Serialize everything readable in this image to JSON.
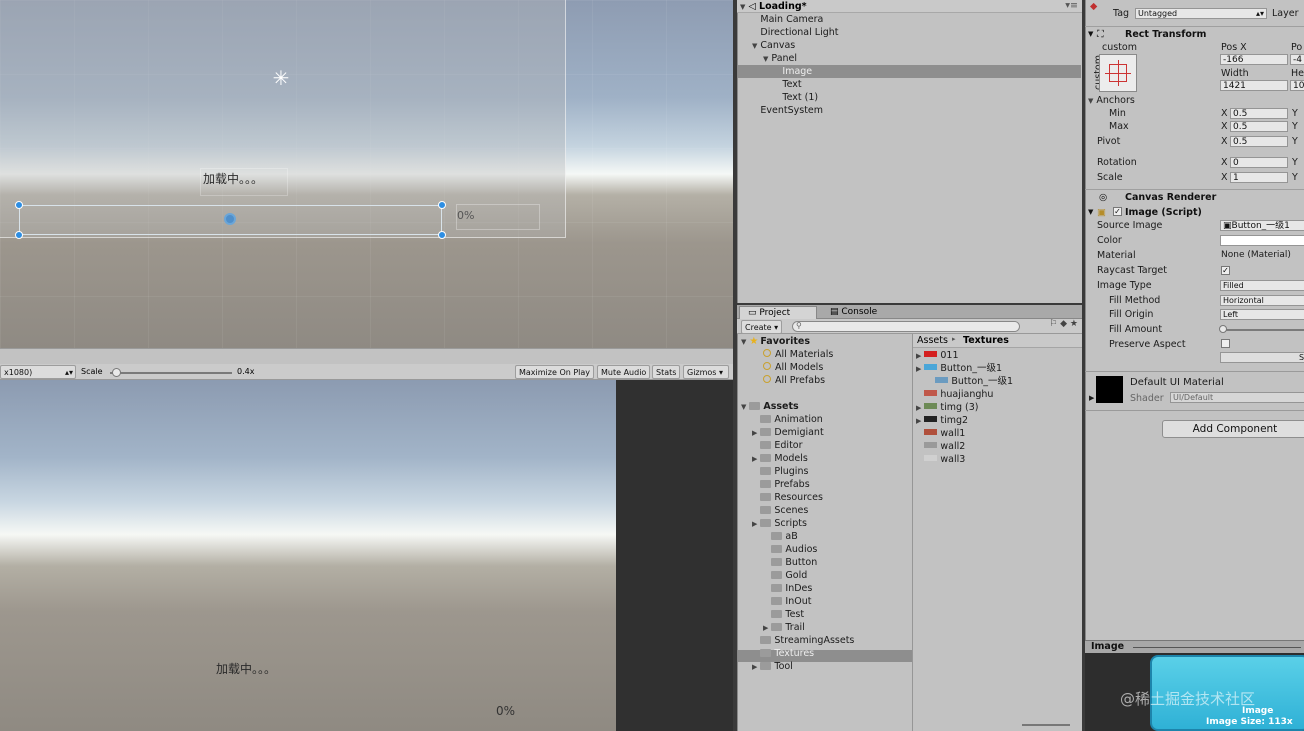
{
  "scene": {
    "loading_text": "加载中。。。",
    "percent_text": "0%"
  },
  "game_toolbar": {
    "resolution": "x1080)",
    "scale_label": "Scale",
    "scale_value": "0.4x",
    "scale_fraction": 0.04,
    "maximize": "Maximize On Play",
    "mute": "Mute Audio",
    "stats": "Stats",
    "gizmos": "Gizmos"
  },
  "game": {
    "loading_text": "加载中。。。",
    "percent_text": "0%"
  },
  "hierarchy": {
    "scene_name": "Loading*",
    "items": [
      {
        "label": "Main Camera",
        "depth": 1,
        "expandable": false
      },
      {
        "label": "Directional Light",
        "depth": 1,
        "expandable": false
      },
      {
        "label": "Canvas",
        "depth": 1,
        "expandable": true
      },
      {
        "label": "Panel",
        "depth": 2,
        "expandable": true
      },
      {
        "label": "Image",
        "depth": 3,
        "expandable": false,
        "selected": true
      },
      {
        "label": "Text",
        "depth": 3,
        "expandable": false
      },
      {
        "label": "Text (1)",
        "depth": 3,
        "expandable": false
      },
      {
        "label": "EventSystem",
        "depth": 1,
        "expandable": false
      }
    ]
  },
  "project": {
    "tab_project": "Project",
    "tab_console": "Console",
    "create_label": "Create",
    "favorites_label": "Favorites",
    "favorites": [
      "All Materials",
      "All Models",
      "All Prefabs"
    ],
    "assets_label": "Assets",
    "assets": [
      {
        "label": "Animation",
        "depth": 1,
        "expandable": false
      },
      {
        "label": "Demigiant",
        "depth": 1,
        "expandable": true
      },
      {
        "label": "Editor",
        "depth": 1,
        "expandable": false
      },
      {
        "label": "Models",
        "depth": 1,
        "expandable": true
      },
      {
        "label": "Plugins",
        "depth": 1,
        "expandable": false
      },
      {
        "label": "Prefabs",
        "depth": 1,
        "expandable": false
      },
      {
        "label": "Resources",
        "depth": 1,
        "expandable": false
      },
      {
        "label": "Scenes",
        "depth": 1,
        "expandable": false
      },
      {
        "label": "Scripts",
        "depth": 1,
        "expandable": true
      },
      {
        "label": "aB",
        "depth": 2,
        "expandable": false
      },
      {
        "label": "Audios",
        "depth": 2,
        "expandable": false
      },
      {
        "label": "Button",
        "depth": 2,
        "expandable": false
      },
      {
        "label": "Gold",
        "depth": 2,
        "expandable": false
      },
      {
        "label": "InDes",
        "depth": 2,
        "expandable": false
      },
      {
        "label": "InOut",
        "depth": 2,
        "expandable": false
      },
      {
        "label": "Test",
        "depth": 2,
        "expandable": false
      },
      {
        "label": "Trail",
        "depth": 2,
        "expandable": true
      },
      {
        "label": "StreamingAssets",
        "depth": 1,
        "expandable": false
      },
      {
        "label": "Textures",
        "depth": 1,
        "expandable": false,
        "selected": true
      },
      {
        "label": "Tool",
        "depth": 1,
        "expandable": true
      }
    ],
    "breadcrumb_root": "Assets",
    "breadcrumb_current": "Textures",
    "files": [
      {
        "label": "011",
        "depth": 0,
        "expandable": true,
        "color": "#d42020"
      },
      {
        "label": "Button_一级1",
        "depth": 0,
        "expandable": true,
        "color": "#4aa6d8"
      },
      {
        "label": "Button_一级1",
        "depth": 1,
        "expandable": false,
        "color": "#6b9bc0"
      },
      {
        "label": "huajianghu",
        "depth": 0,
        "expandable": false,
        "color": "#c0584a"
      },
      {
        "label": "timg (3)",
        "depth": 0,
        "expandable": true,
        "color": "#6d8a56"
      },
      {
        "label": "timg2",
        "depth": 0,
        "expandable": true,
        "color": "#222222"
      },
      {
        "label": "wall1",
        "depth": 0,
        "expandable": false,
        "color": "#b0503c"
      },
      {
        "label": "wall2",
        "depth": 0,
        "expandable": false,
        "color": "#9a9a9a"
      },
      {
        "label": "wall3",
        "depth": 0,
        "expandable": false,
        "color": "#d0d0d0"
      }
    ]
  },
  "inspector": {
    "tag_label": "Tag",
    "tag_value": "Untagged",
    "layer_label": "Layer",
    "rect_transform": "Rect Transform",
    "custom": "custom",
    "pos_x_label": "Pos X",
    "pos_y_label": "Po",
    "pos_x": "-166",
    "pos_y": "-4",
    "width_label": "Width",
    "height_label": "He",
    "width": "1421",
    "height": "10",
    "anchors_label": "Anchors",
    "min_label": "Min",
    "max_label": "Max",
    "pivot_label": "Pivot",
    "rotation_label": "Rotation",
    "scale_label": "Scale",
    "axis_x": "X",
    "axis_y": "Y",
    "min_x": "0.5",
    "max_x": "0.5",
    "pivot_x": "0.5",
    "rotation_x": "0",
    "scale_x": "1",
    "canvas_renderer": "Canvas Renderer",
    "image_script": "Image (Script)",
    "source_image_label": "Source Image",
    "source_image": "Button_一级1",
    "color_label": "Color",
    "material_label": "Material",
    "material": "None (Material)",
    "raycast_label": "Raycast Target",
    "image_type_label": "Image Type",
    "image_type": "Filled",
    "fill_method_label": "Fill Method",
    "fill_method": "Horizontal",
    "fill_origin_label": "Fill Origin",
    "fill_origin": "Left",
    "fill_amount_label": "Fill Amount",
    "fill_amount": 0,
    "preserve_label": "Preserve Aspect",
    "set_native": "Se",
    "default_material": "Default UI Material",
    "shader_label": "Shader",
    "shader_value": "UI/Default",
    "add_component": "Add Component",
    "preview_title": "Image",
    "preview_label": "Image",
    "preview_size": "Image Size: 113x",
    "watermark": "@稀土掘金技术社区"
  },
  "colors": {
    "selection": "#8e8e8e",
    "panel": "#c2c2c2",
    "handle": "#2d8ee3"
  }
}
